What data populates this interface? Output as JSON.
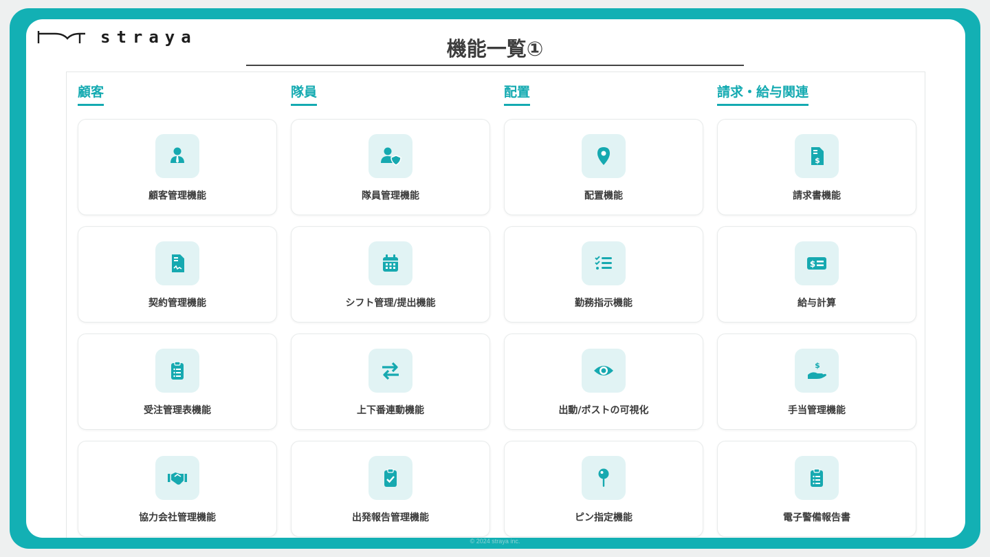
{
  "logo": {
    "text": "straya"
  },
  "title": "機能一覧①",
  "columns": [
    {
      "heading": "顧客",
      "cards": [
        {
          "label": "顧客管理機能",
          "icon": "person-tie-icon"
        },
        {
          "label": "契約管理機能",
          "icon": "contract-document-icon"
        },
        {
          "label": "受注管理表機能",
          "icon": "clipboard-list-icon"
        },
        {
          "label": "協力会社管理機能",
          "icon": "handshake-icon"
        }
      ]
    },
    {
      "heading": "隊員",
      "cards": [
        {
          "label": "隊員管理機能",
          "icon": "user-shield-icon"
        },
        {
          "label": "シフト管理/提出機能",
          "icon": "calendar-icon"
        },
        {
          "label": "上下番連動機能",
          "icon": "exchange-arrows-icon"
        },
        {
          "label": "出発報告管理機能",
          "icon": "clipboard-check-icon"
        }
      ]
    },
    {
      "heading": "配置",
      "cards": [
        {
          "label": "配置機能",
          "icon": "map-pin-icon"
        },
        {
          "label": "勤務指示機能",
          "icon": "checklist-icon"
        },
        {
          "label": "出動/ポストの可視化",
          "icon": "eye-icon"
        },
        {
          "label": "ピン指定機能",
          "icon": "push-pin-icon"
        }
      ]
    },
    {
      "heading": "請求・給与関連",
      "cards": [
        {
          "label": "請求書機能",
          "icon": "invoice-dollar-icon"
        },
        {
          "label": "給与計算",
          "icon": "money-check-icon"
        },
        {
          "label": "手当管理機能",
          "icon": "hand-dollar-icon"
        },
        {
          "label": "電子警備報告書",
          "icon": "clipboard-list-icon"
        }
      ]
    }
  ],
  "footer": "© 2024 straya inc.",
  "colors": {
    "accent": "#14aab1",
    "frame": "#13b0b4",
    "icon_bg": "#e1f3f4"
  }
}
